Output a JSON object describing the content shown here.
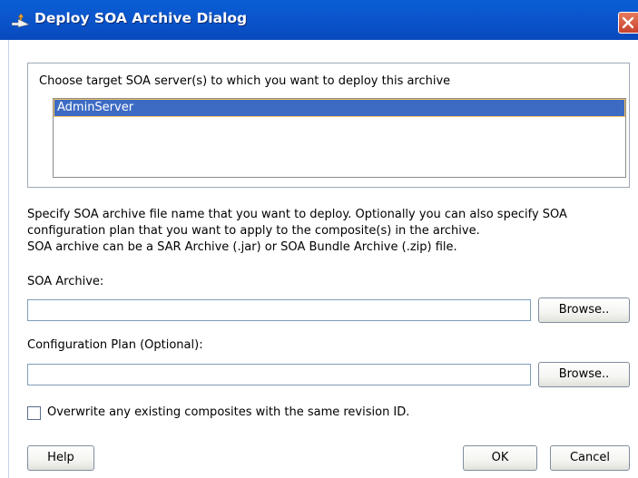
{
  "window": {
    "title": "Deploy SOA Archive Dialog",
    "icon": "deploy-arrow-icon",
    "close_icon": "close-icon"
  },
  "target_servers": {
    "label": "Choose target SOA server(s) to which you want to deploy this archive",
    "items": [
      "AdminServer"
    ],
    "selected": "AdminServer"
  },
  "description": {
    "line1": "Specify SOA archive file name that you want to deploy. Optionally you can also specify SOA",
    "line2": "configuration plan that you want to apply to the composite(s) in the archive.",
    "line3": "SOA archive can be a SAR Archive (.jar) or SOA Bundle Archive (.zip) file."
  },
  "soa_archive": {
    "label": "SOA Archive:",
    "value": "",
    "browse_label": "Browse.."
  },
  "config_plan": {
    "label": "Configuration Plan (Optional):",
    "value": "",
    "browse_label": "Browse.."
  },
  "overwrite": {
    "label": "Overwrite any existing composites with the same revision ID.",
    "checked": false
  },
  "buttons": {
    "help": "Help",
    "ok": "OK",
    "cancel": "Cancel"
  },
  "colors": {
    "titlebar": "#0b56cd",
    "selection": "#3d6bc4",
    "close": "#c8412c"
  }
}
